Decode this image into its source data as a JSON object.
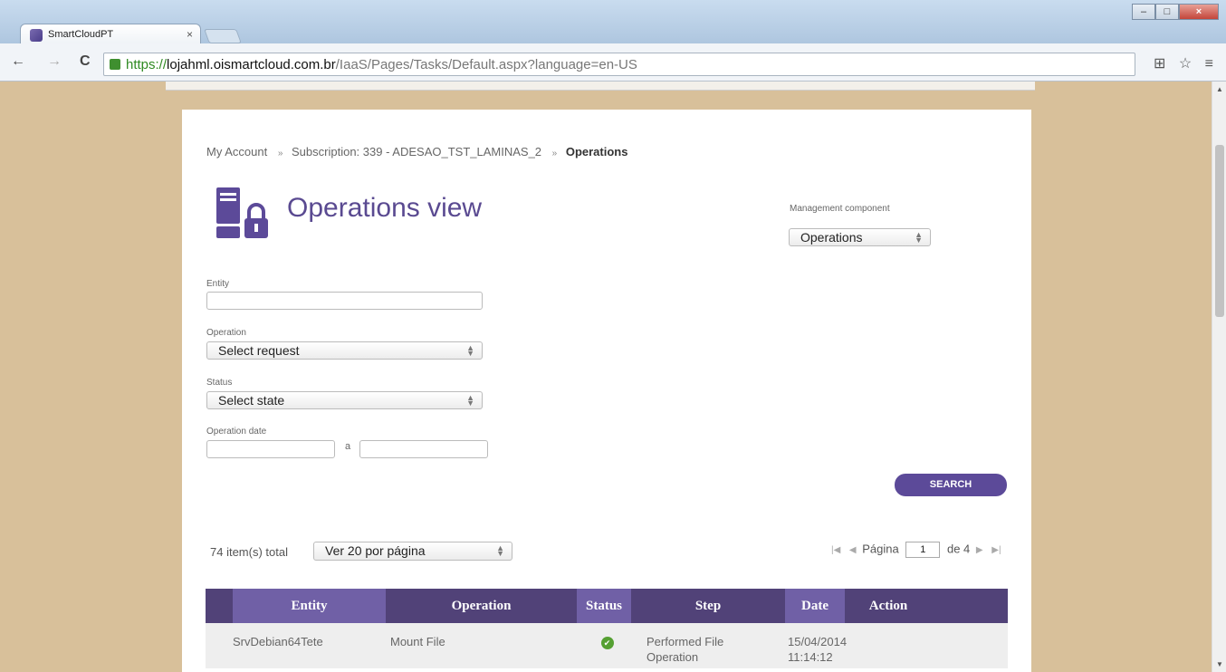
{
  "browser": {
    "tab_title": "SmartCloudPT",
    "tab_close": "×",
    "url_scheme": "https://",
    "url_host": "lojahml.oismartcloud.com.br",
    "url_path": "/IaaS/Pages/Tasks/Default.aspx?language=en-US",
    "back": "←",
    "forward": "→",
    "reload": "C"
  },
  "breadcrumb": {
    "item1": "My Account",
    "item2": "Subscription: 339 - ADESAO_TST_LAMINAS_2",
    "current": "Operations",
    "separator": "»"
  },
  "page": {
    "title": "Operations view"
  },
  "management": {
    "label": "Management component",
    "value": "Operations"
  },
  "filters": {
    "entity_label": "Entity",
    "entity_value": "",
    "operation_label": "Operation",
    "operation_value": "Select request",
    "status_label": "Status",
    "status_value": "Select state",
    "date_label": "Operation date",
    "date_sep": "a",
    "date_from": "",
    "date_to": ""
  },
  "search_label": "SEARCH",
  "results": {
    "total": "74 item(s) total",
    "per_page": "Ver 20 por página",
    "pager_label": "Página",
    "page": "1",
    "of": "de 4"
  },
  "table": {
    "headers": [
      "Entity",
      "Operation",
      "Status",
      "Step",
      "Date",
      "Action"
    ],
    "rows": [
      {
        "entity": "SrvDebian64Tete",
        "operation": "Mount File",
        "status": "success",
        "step_line1": "Performed File",
        "step_line2": "Operation",
        "date_line1": "15/04/2014",
        "date_line2": "11:14:12",
        "action": ""
      }
    ]
  },
  "colors": {
    "brand_purple": "#5c4a99",
    "header_purple": "#514278",
    "header_highlight": "#7060a6",
    "background_tan": "#d8c09a",
    "success_green": "#55a032"
  }
}
